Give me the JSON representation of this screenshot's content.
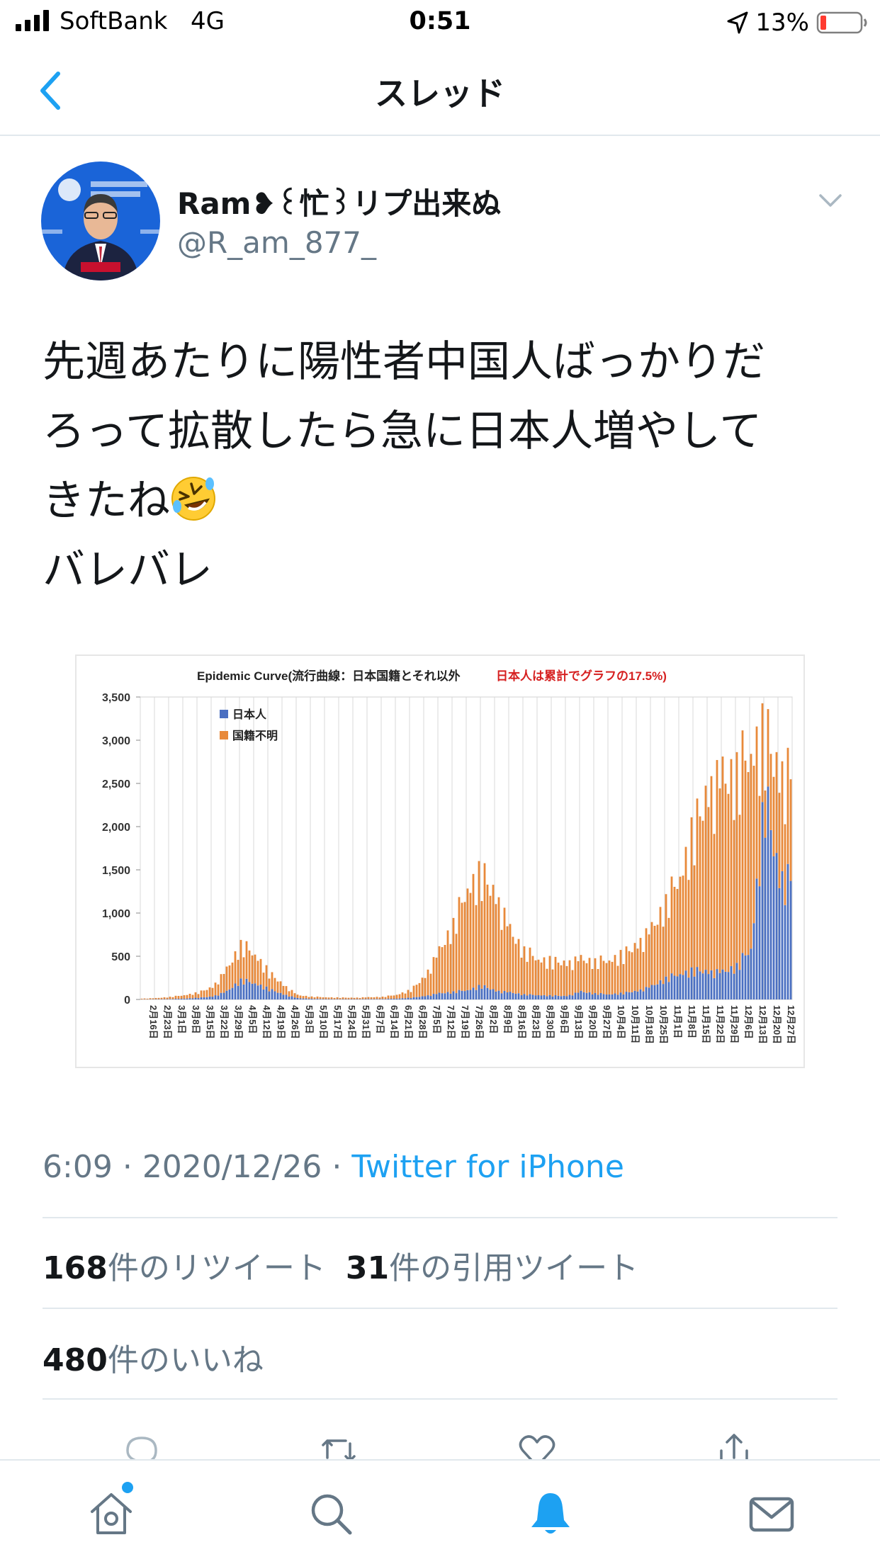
{
  "status_bar": {
    "carrier": "SoftBank",
    "network": "4G",
    "time": "0:51",
    "battery": "13%"
  },
  "nav": {
    "title": "スレッド",
    "back_icon": "chevron-left-icon"
  },
  "tweet": {
    "display_name": "Ram❥꒰忙꒱リプ出来ぬ",
    "handle": "@R_am_877_",
    "text_lines": [
      "先週あたりに陽性者中国人ばっかりだ",
      "ろって拡散したら急に日本人増やして",
      "きたね",
      "バレバレ"
    ],
    "emoji": "rolling-on-floor-laughing",
    "time": "6:09",
    "date": "2020/12/26",
    "separator": "·",
    "source": "Twitter for iPhone",
    "retweets_count": "168",
    "retweets_label": "件のリツイート",
    "quotes_count": "31",
    "quotes_label": "件の引用ツイート",
    "likes_count": "480",
    "likes_label": "件のいいね"
  },
  "colors": {
    "accent": "#1da1f2",
    "japanese": "#4a6fc1",
    "unknown": "#e8893a",
    "red_note": "#d62020"
  },
  "chart_data": {
    "type": "bar",
    "stacked": true,
    "title": "Epidemic Curve(流行曲線：日本国籍とそれ以外",
    "title_note": "日本人は累計でグラフの17.5%)",
    "legend": [
      "日本人",
      "国籍不明"
    ],
    "legend_position": "top-left",
    "ylim": [
      0,
      3500
    ],
    "yticks": [
      "3,500",
      "3,000",
      "2,500",
      "2,000",
      "1,500",
      "1,000",
      "500",
      "0"
    ],
    "xticks": [
      "2月16日",
      "2月23日",
      "3月1日",
      "3月8日",
      "3月15日",
      "3月22日",
      "3月29日",
      "4月5日",
      "4月12日",
      "4月19日",
      "4月26日",
      "5月3日",
      "5月10日",
      "5月17日",
      "5月24日",
      "5月31日",
      "6月7日",
      "6月14日",
      "6月21日",
      "6月28日",
      "7月5日",
      "7月12日",
      "7月19日",
      "7月26日",
      "8月2日",
      "8月9日",
      "8月16日",
      "8月23日",
      "8月30日",
      "9月6日",
      "9月13日",
      "9月20日",
      "9月27日",
      "10月4日",
      "10月11日",
      "10月18日",
      "10月25日",
      "11月1日",
      "11月8日",
      "11月15日",
      "11月22日",
      "11月29日",
      "12月6日",
      "12月13日",
      "12月20日",
      "12月27日"
    ],
    "grid": true,
    "weekly_series": [
      {
        "name": "日本人",
        "values": [
          2,
          3,
          5,
          10,
          20,
          35,
          90,
          230,
          190,
          120,
          60,
          15,
          8,
          5,
          4,
          4,
          5,
          6,
          10,
          20,
          40,
          70,
          90,
          110,
          160,
          100,
          80,
          60,
          50,
          45,
          40,
          90,
          70,
          60,
          75,
          100,
          150,
          250,
          300,
          340,
          320,
          310,
          400,
          600,
          2400,
          1400
        ]
      },
      {
        "name": "国籍不明",
        "values": [
          8,
          12,
          25,
          40,
          60,
          110,
          250,
          420,
          340,
          190,
          110,
          35,
          25,
          20,
          18,
          16,
          20,
          25,
          45,
          90,
          230,
          480,
          800,
          1200,
          1300,
          1100,
          700,
          520,
          420,
          400,
          380,
          370,
          380,
          400,
          450,
          540,
          650,
          900,
          1150,
          1650,
          2100,
          2200,
          2300,
          2300,
          700,
          1200
        ]
      }
    ]
  }
}
